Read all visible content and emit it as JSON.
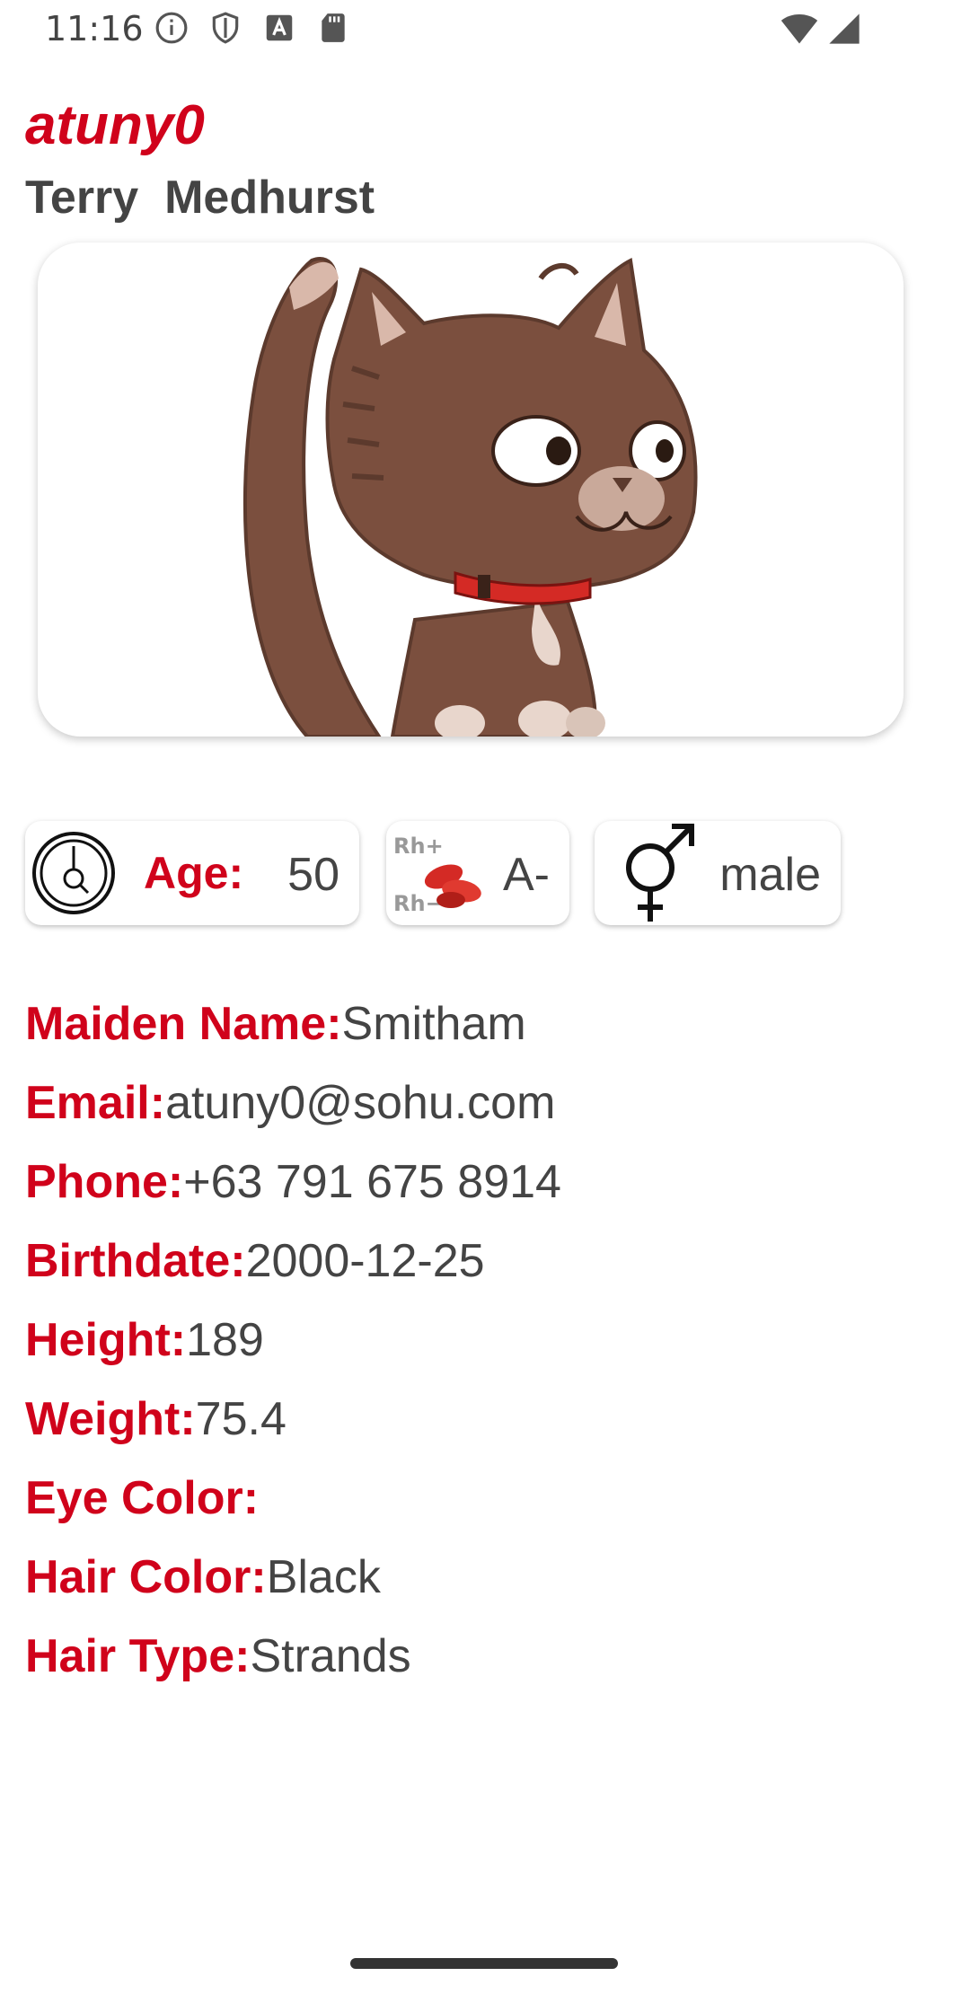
{
  "status_bar": {
    "time": "11:16",
    "left_icons": [
      "info-icon",
      "shield-icon",
      "keyboard-a-icon",
      "sd-card-icon"
    ],
    "right_icons": [
      "wifi-icon",
      "cell-signal-icon"
    ]
  },
  "profile": {
    "username": "atuny0",
    "full_name": "Terry  Medhurst"
  },
  "chips": {
    "age_label": "Age:",
    "age_value": "50",
    "blood_value": "A-",
    "gender_value": "male",
    "blood_plus": "Rh+",
    "blood_minus": "Rh−"
  },
  "details": [
    {
      "label": "Maiden Name:",
      "value": "Smitham"
    },
    {
      "label": "Email:",
      "value": "atuny0@sohu.com"
    },
    {
      "label": "Phone:",
      "value": "+63 791 675 8914"
    },
    {
      "label": "Birthdate:",
      "value": "2000-12-25"
    },
    {
      "label": "Height:",
      "value": "189"
    },
    {
      "label": "Weight:",
      "value": "75.4"
    },
    {
      "label": "Eye Color:",
      "value": ""
    },
    {
      "label": "Hair Color:",
      "value": "Black"
    },
    {
      "label": "Hair Type:",
      "value": "Strands"
    }
  ],
  "colors": {
    "accent": "#d0021b",
    "text": "#444444",
    "cat_brown": "#7b4f3e",
    "collar": "#d42a25"
  }
}
